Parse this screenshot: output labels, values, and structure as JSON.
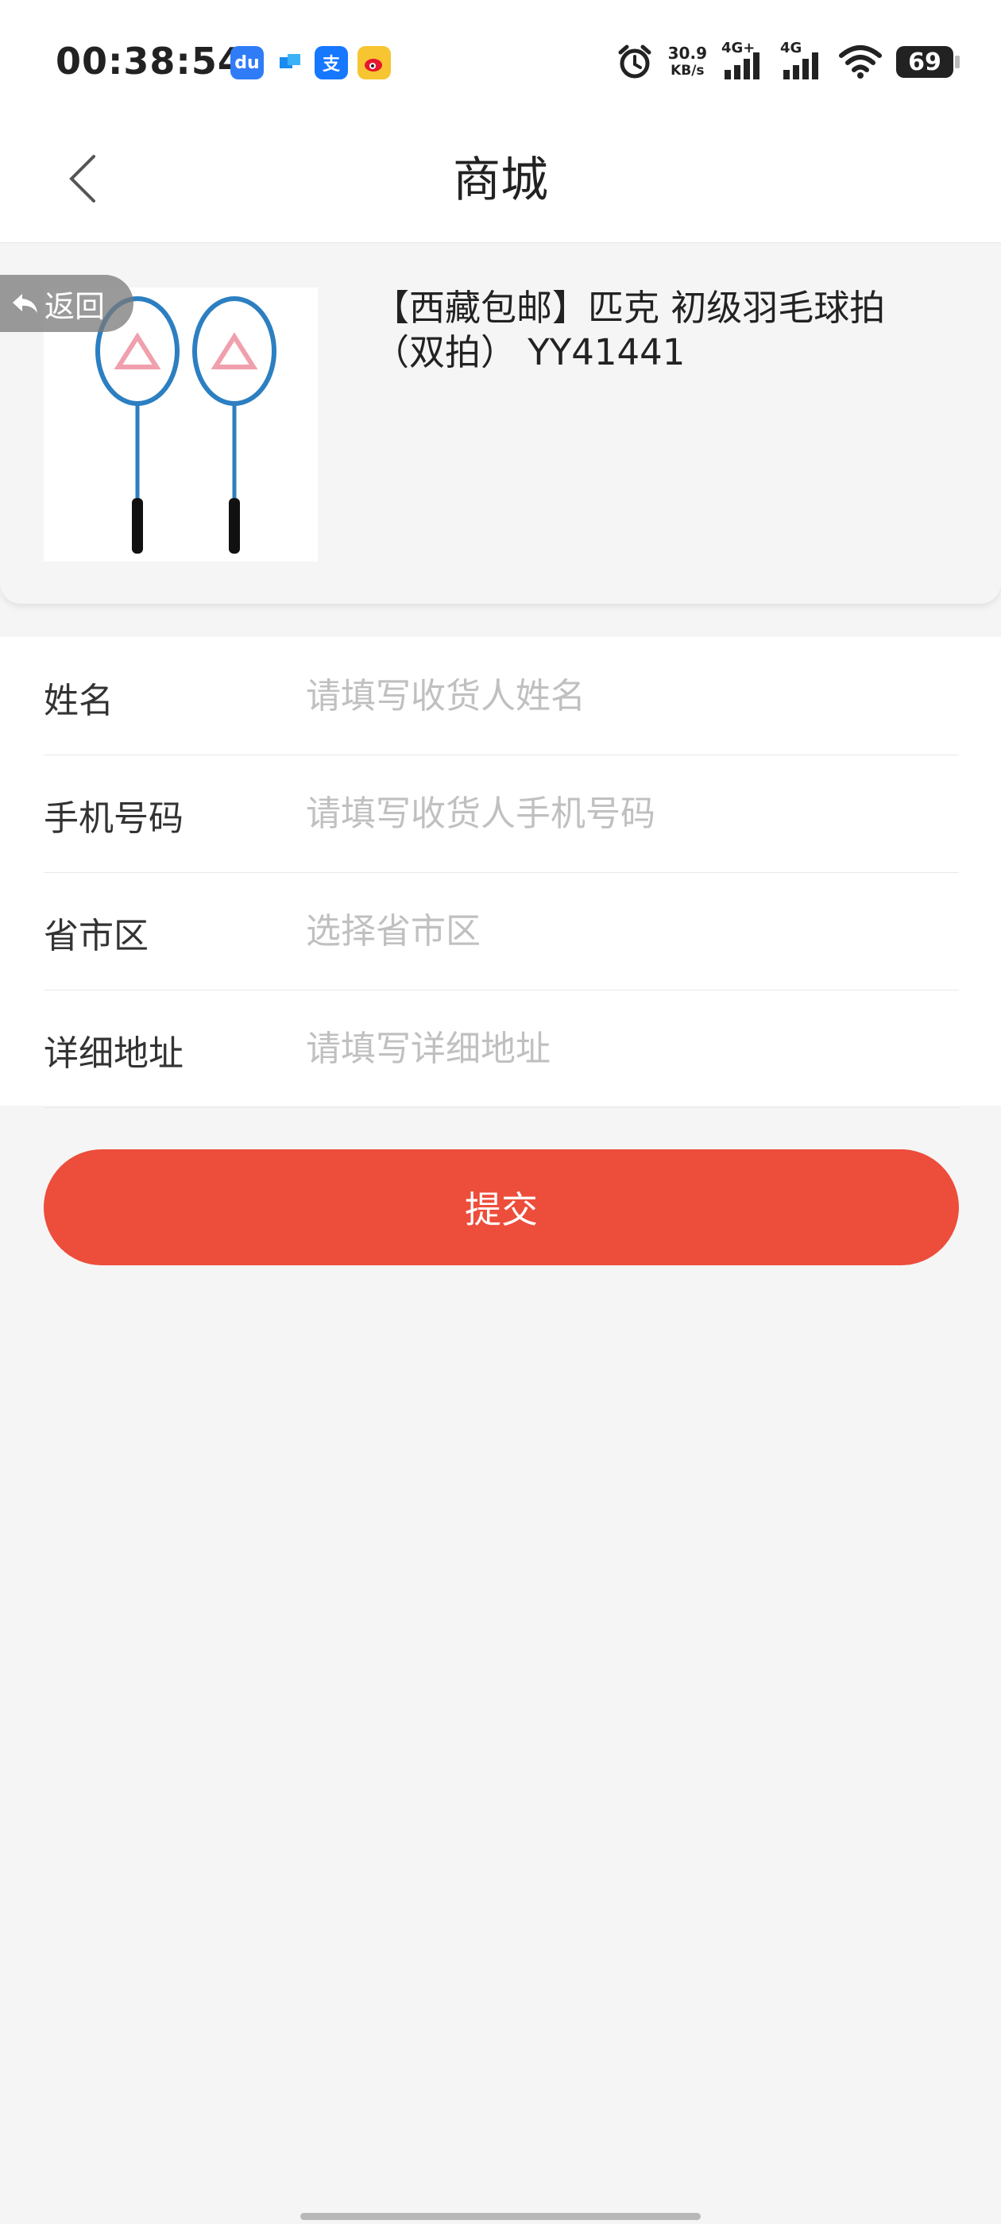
{
  "status_bar": {
    "time": "00:38:54",
    "net_speed_value": "30.9",
    "net_speed_unit": "KB/s",
    "signal_1": "4G+",
    "signal_2": "4G",
    "battery": "69",
    "app_icons": [
      "baidu-icon",
      "dingtalk-icon",
      "alipay-icon",
      "weibo-icon"
    ]
  },
  "nav": {
    "title": "商城"
  },
  "product": {
    "title": "【西藏包邮】匹克 初级羽毛球拍（双拍） YY41441",
    "return_label": "返回"
  },
  "form": {
    "fields": [
      {
        "label": "姓名",
        "placeholder": "请填写收货人姓名",
        "value": ""
      },
      {
        "label": "手机号码",
        "placeholder": "请填写收货人手机号码",
        "value": ""
      },
      {
        "label": "省市区",
        "placeholder": "选择省市区",
        "value": ""
      },
      {
        "label": "详细地址",
        "placeholder": "请填写详细地址",
        "value": ""
      }
    ],
    "submit_label": "提交"
  },
  "colors": {
    "accent": "#ed4d3b",
    "background": "#f5f5f5"
  }
}
